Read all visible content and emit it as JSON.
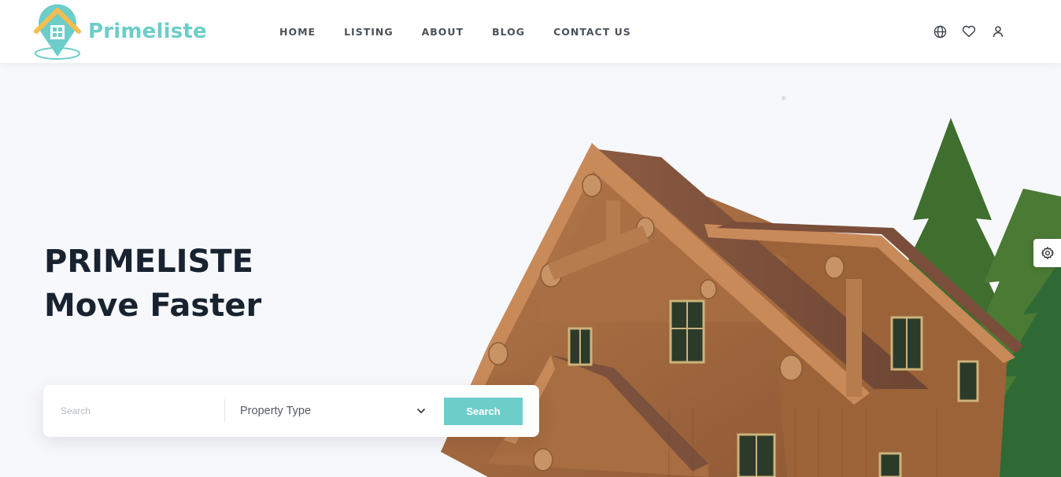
{
  "brand": {
    "name": "Primeliste",
    "accent": "#6dcdc9",
    "logo_roof_color": "#f5bd4f"
  },
  "nav": {
    "items": [
      "HOME",
      "LISTING",
      "ABOUT",
      "BLOG",
      "CONTACT US"
    ]
  },
  "header_icons": [
    "globe-icon",
    "heart-icon",
    "user-icon"
  ],
  "hero": {
    "title_line1": "PRIMELISTE",
    "title_line2": "Move Faster"
  },
  "search": {
    "placeholder": "Search",
    "property_type": "Property Type",
    "button_label": "Search"
  },
  "settings": {
    "icon": "gear-icon"
  }
}
